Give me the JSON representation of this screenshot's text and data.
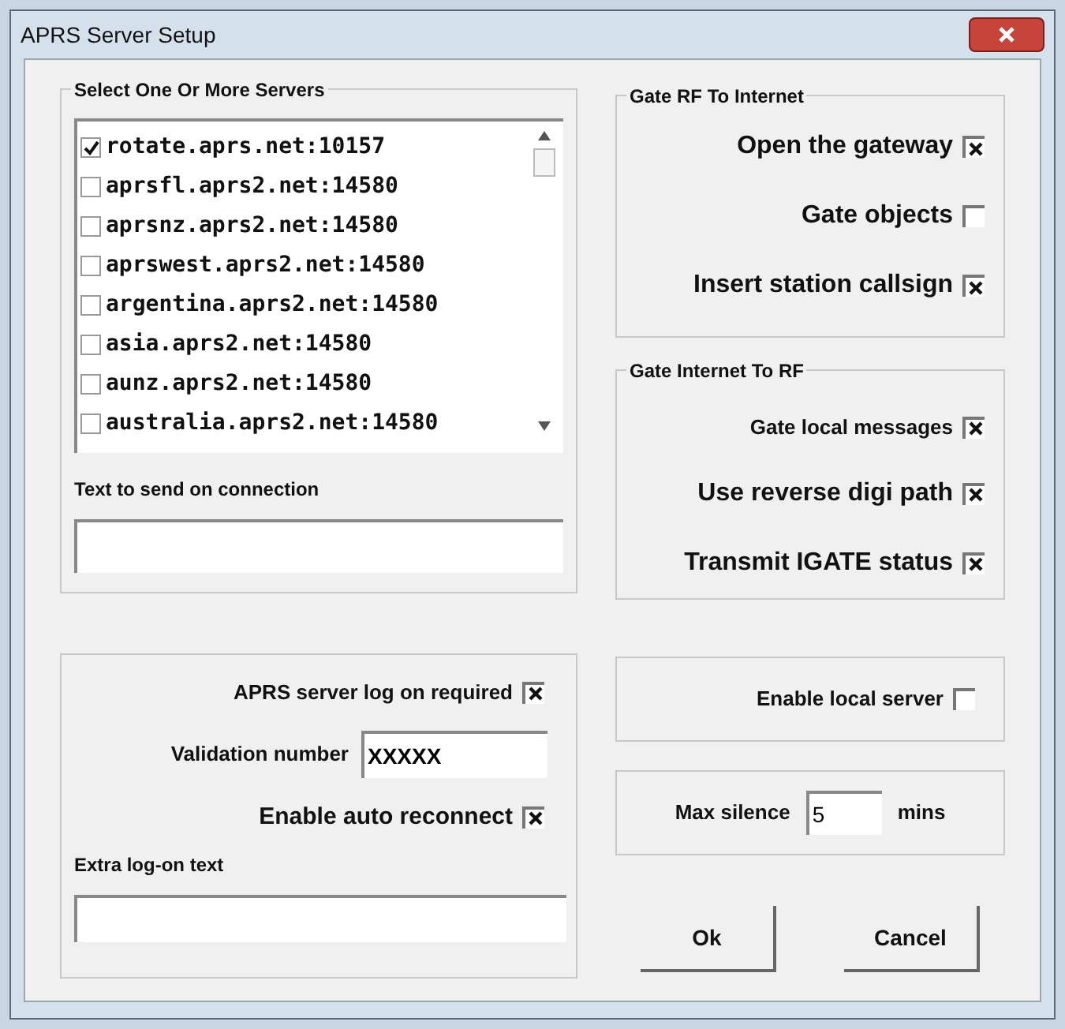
{
  "window": {
    "title": "APRS Server Setup"
  },
  "servers": {
    "title": "Select One Or More Servers",
    "items": [
      {
        "label": "rotate.aprs.net:10157",
        "checked": true
      },
      {
        "label": "aprsfl.aprs2.net:14580",
        "checked": false
      },
      {
        "label": "aprsnz.aprs2.net:14580",
        "checked": false
      },
      {
        "label": "aprswest.aprs2.net:14580",
        "checked": false
      },
      {
        "label": "argentina.aprs2.net:14580",
        "checked": false
      },
      {
        "label": "asia.aprs2.net:14580",
        "checked": false
      },
      {
        "label": "aunz.aprs2.net:14580",
        "checked": false
      },
      {
        "label": "australia.aprs2.net:14580",
        "checked": false
      }
    ],
    "connection_label": "Text to send on connection"
  },
  "gate_rf_to_internet": {
    "title": "Gate RF To Internet",
    "options": [
      {
        "label": "Open the gateway",
        "checked": true
      },
      {
        "label": "Gate objects",
        "checked": false
      },
      {
        "label": "Insert station callsign",
        "checked": true
      }
    ]
  },
  "gate_internet_to_rf": {
    "title": "Gate Internet To RF",
    "options": [
      {
        "label": "Gate local messages",
        "checked": true
      },
      {
        "label": "Use reverse digi path",
        "checked": true
      },
      {
        "label": "Transmit IGATE status",
        "checked": true
      }
    ]
  },
  "logon": {
    "required": {
      "label": "APRS server log on required",
      "checked": true
    },
    "validation_label": "Validation number",
    "validation_value": "XXXXX",
    "reconnect": {
      "label": "Enable auto reconnect",
      "checked": true
    },
    "extra_label": "Extra log-on text"
  },
  "local_server": {
    "label": "Enable local server",
    "checked": false
  },
  "max_silence": {
    "label": "Max silence",
    "value": "5",
    "unit": "mins"
  },
  "buttons": [
    "Ok",
    "Cancel"
  ]
}
